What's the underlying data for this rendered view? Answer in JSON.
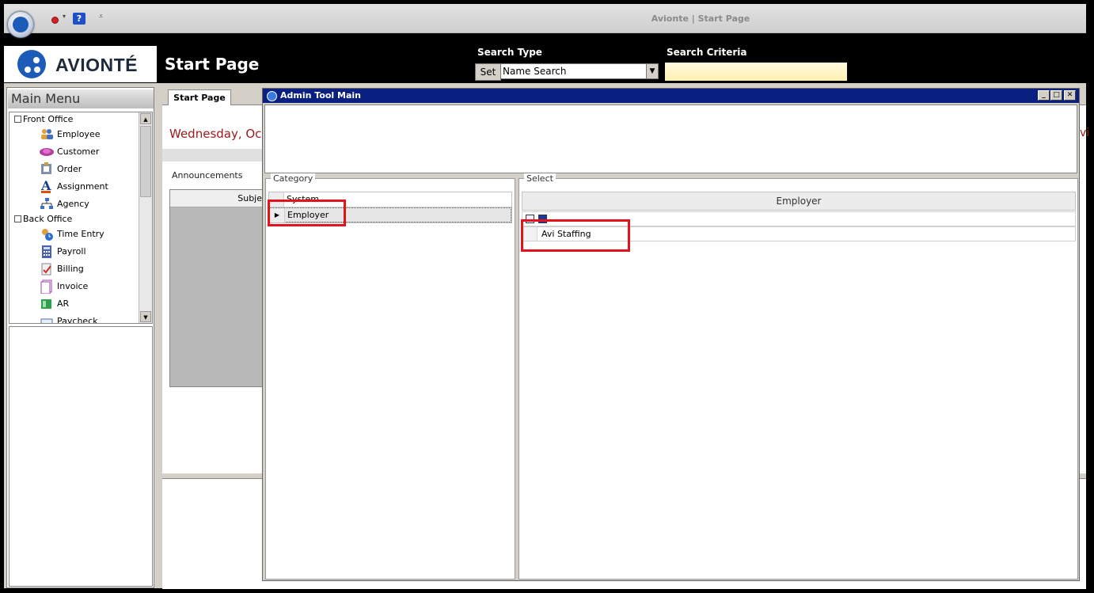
{
  "app": {
    "window_title": "Avionte | Start Page",
    "qat_help_label": "?",
    "logo_text": "AVIONTÉ"
  },
  "header": {
    "page_title": "Start Page",
    "search_type_label": "Search Type",
    "set_label": "Set",
    "search_type_value": "Name Search",
    "search_criteria_label": "Search Criteria",
    "search_criteria_value": ""
  },
  "sidebar": {
    "title": "Main Menu",
    "groups": [
      {
        "label": "Front Office",
        "items": [
          {
            "label": "Employee",
            "icon": "people-icon"
          },
          {
            "label": "Customer",
            "icon": "customer-icon"
          },
          {
            "label": "Order",
            "icon": "order-icon"
          },
          {
            "label": "Assignment",
            "icon": "assignment-icon"
          },
          {
            "label": "Agency",
            "icon": "agency-icon"
          }
        ]
      },
      {
        "label": "Back Office",
        "items": [
          {
            "label": "Time Entry",
            "icon": "time-entry-icon"
          },
          {
            "label": "Payroll",
            "icon": "payroll-icon"
          },
          {
            "label": "Billing",
            "icon": "billing-icon"
          },
          {
            "label": "Invoice",
            "icon": "invoice-icon"
          },
          {
            "label": "AR",
            "icon": "ar-icon"
          },
          {
            "label": "Paycheck",
            "icon": "paycheck-icon"
          }
        ]
      }
    ]
  },
  "start_page": {
    "tab_label": "Start Page",
    "date_text": "Wednesday, Oc",
    "announcements_label": "Announcements",
    "grid_header": "Subje",
    "right_edge_text": "vi"
  },
  "dialog": {
    "title": "Admin Tool Main",
    "category": {
      "legend": "Category",
      "rows": [
        "System",
        "Employer"
      ],
      "selected": "Employer"
    },
    "select": {
      "legend": "Select",
      "column_header": "Employer",
      "rows": [
        "Avi Staffing"
      ]
    }
  },
  "colors": {
    "highlight": "#e3121c",
    "dialog_titlebar": "#0a2080",
    "brand_blue": "#1c5bb8",
    "date_red": "#a11a1a"
  }
}
